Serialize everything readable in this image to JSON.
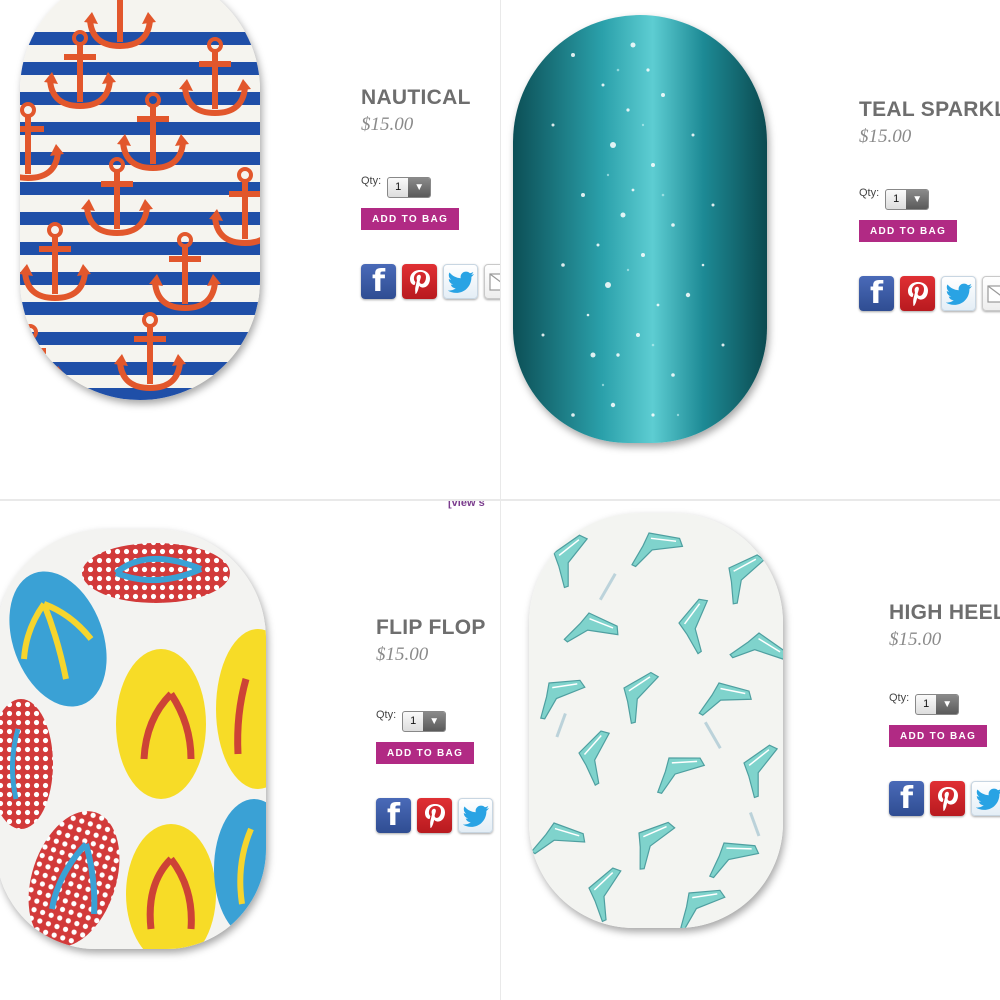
{
  "products": [
    {
      "id": "nautical",
      "name": "NAUTICAL",
      "price": "$15.00",
      "qty_label": "Qty:",
      "qty_value": "1",
      "add_label": "ADD TO BAG"
    },
    {
      "id": "teal",
      "name": "TEAL SPARKLE",
      "price": "$15.00",
      "qty_label": "Qty:",
      "qty_value": "1",
      "add_label": "ADD TO BAG"
    },
    {
      "id": "flipflop",
      "name": "FLIP FLOP",
      "price": "$15.00",
      "qty_label": "Qty:",
      "qty_value": "1",
      "add_label": "ADD TO BAG"
    },
    {
      "id": "heels",
      "name": "HIGH HEELS",
      "price": "$15.00",
      "qty_label": "Qty:",
      "qty_value": "1",
      "add_label": "ADD TO BAG"
    }
  ],
  "social": {
    "facebook_glyph": "f"
  },
  "links": {
    "view_more": "[view s"
  },
  "colors": {
    "button": "#b12a84",
    "title": "#6e6e6e",
    "price": "#8a8a8a"
  }
}
